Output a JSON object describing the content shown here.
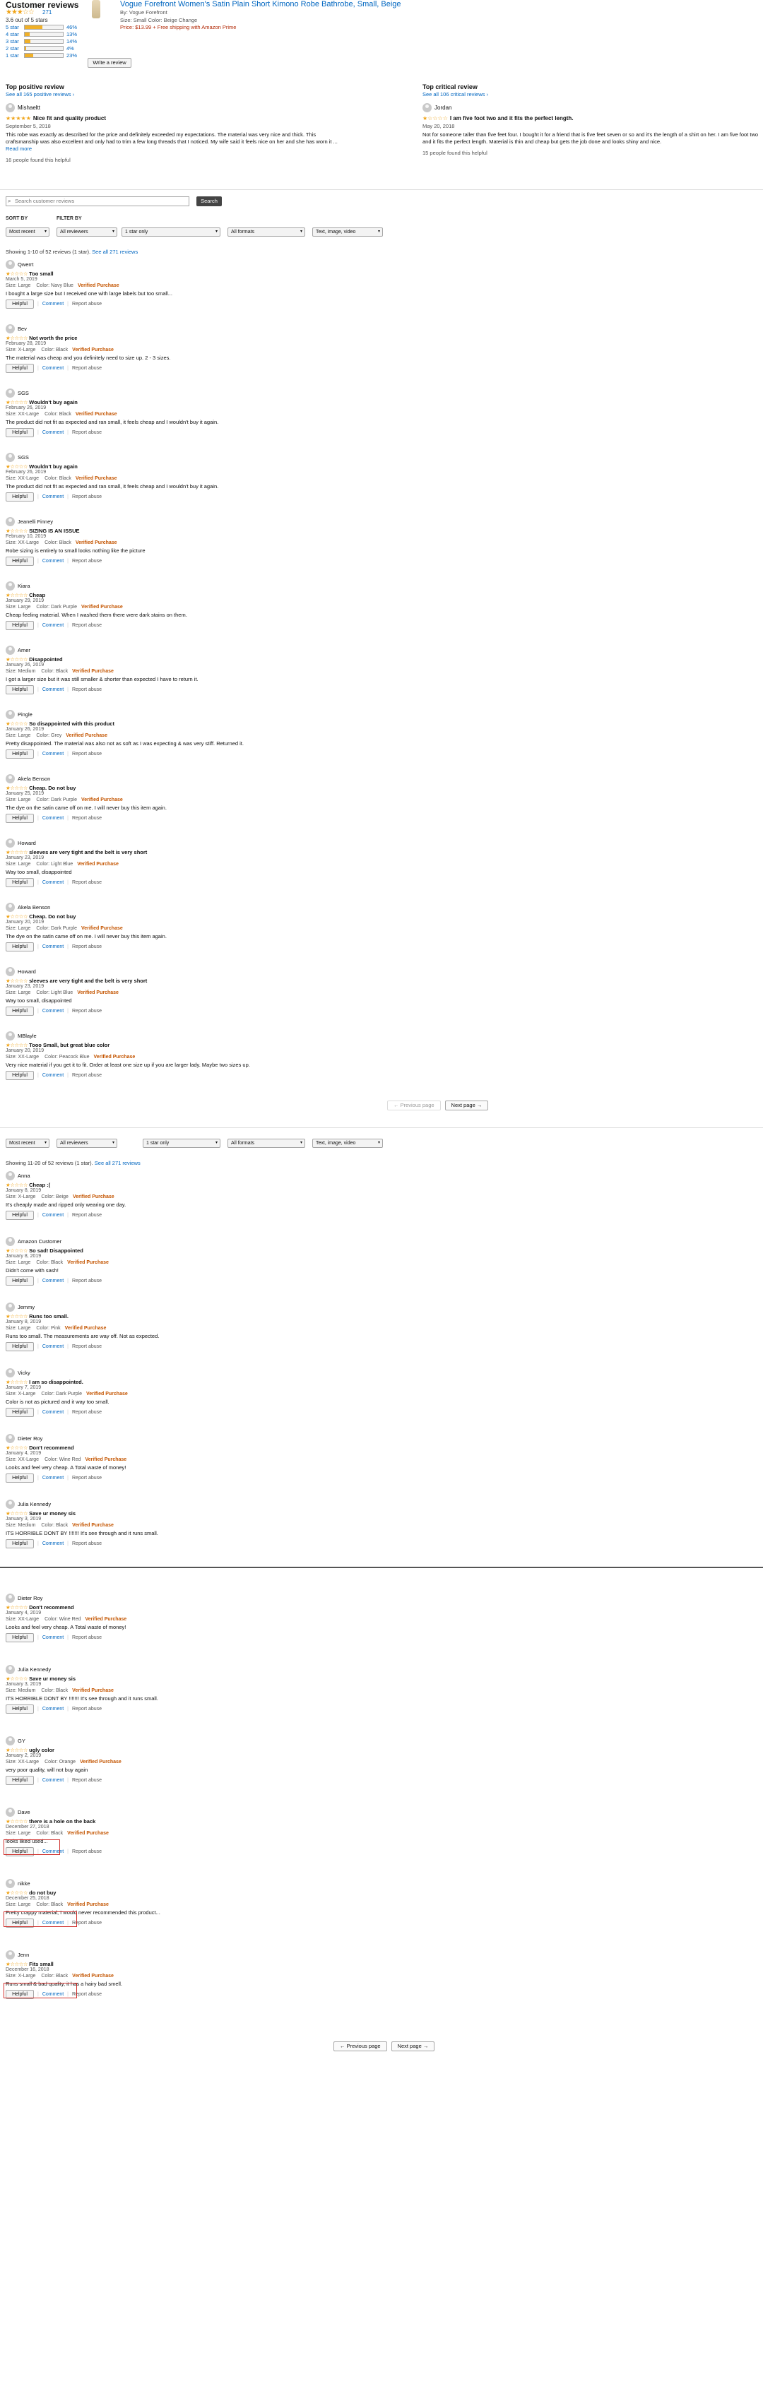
{
  "header": {
    "title": "Customer reviews",
    "avg_stars": "★★★☆☆",
    "review_count": "271",
    "out_of": "3.6 out of 5 stars",
    "histogram": [
      {
        "label": "5 star",
        "pct": "46%",
        "value": 46
      },
      {
        "label": "4 star",
        "pct": "13%",
        "value": 13
      },
      {
        "label": "3 star",
        "pct": "14%",
        "value": 14
      },
      {
        "label": "2 star",
        "pct": "4%",
        "value": 4
      },
      {
        "label": "1 star",
        "pct": "23%",
        "value": 23
      }
    ],
    "write_review": "Write a review"
  },
  "product": {
    "title": "Vogue Forefront Women's Satin Plain Short Kimono Robe Bathrobe, Small, Beige",
    "by": "By: Vogue Forefront",
    "meta": "Size: Small    Color: Beige    Change",
    "price": "Price: $13.99 + Free shipping with Amazon Prime"
  },
  "top_positive": {
    "heading": "Top positive review",
    "sub": "See all 165 positive reviews ›",
    "user": "Mishaeltt",
    "stars": "★★★★★",
    "title": "Nice fit and quality product",
    "date": "September 5, 2018",
    "text": "This robe was exactly as described for the price and definitely exceeded my expectations. The material was very nice and thick. This craftsmanship was also excellent and only had to trim a few long threads that I noticed. My wife said it feels nice on her and she has worn it ...",
    "more": "Read more",
    "found": "16 people found this helpful"
  },
  "top_critical": {
    "heading": "Top critical review",
    "sub": "See all 106 critical reviews ›",
    "user": "Jordan",
    "stars": "★☆☆☆☆",
    "title": "I am five foot two and it fits the perfect length.",
    "date": "May 20, 2018",
    "text": "Not for someone taller than five feet four. I bought it for a friend that is five feet seven or so and it's the length of a shirt on her. I am five foot two and it fits the perfect length. Material is thin and cheap but gets the job done and looks shiny and nice.",
    "found": "15 people found this helpful"
  },
  "search": {
    "placeholder": "Search customer reviews",
    "button": "Search"
  },
  "filters": {
    "sort_label": "SORT BY",
    "filter_label": "FILTER BY",
    "sort": "Most recent",
    "reviewers": "All reviewers",
    "stars": "1 star only",
    "formats": "All formats",
    "media": "Text, image, video"
  },
  "showing_1": {
    "text": "Showing 1-10 of 52 reviews (1 star).",
    "link": "See all 271 reviews"
  },
  "showing_2": {
    "text": "Showing 11-20 of 52 reviews (1 star).",
    "link": "See all 271 reviews"
  },
  "labels": {
    "helpful": "Helpful",
    "comment": "Comment",
    "report": "Report abuse",
    "verified": "Verified Purchase",
    "prev": "← Previous page",
    "next": "Next page →"
  },
  "reviews_1": [
    {
      "user": "Qwerrt",
      "stars": "★☆☆☆☆",
      "title": "Too small",
      "date": "March 5, 2019",
      "size": "Size: Large",
      "color": "Color: Navy Blue",
      "text": "I bought a large size but I received one with large labels but too small..."
    },
    {
      "user": "Bev",
      "stars": "★☆☆☆☆",
      "title": "Not worth the price",
      "date": "February 28, 2019",
      "size": "Size: X-Large",
      "color": "Color: Black",
      "text": "The material was cheap and you definitely need to size up. 2 - 3 sizes."
    },
    {
      "user": "SGS",
      "stars": "★☆☆☆☆",
      "title": "Wouldn't buy again",
      "date": "February 26, 2019",
      "size": "Size: XX-Large",
      "color": "Color: Black",
      "text": "The product did not fit as expected and ran small, it feels cheap and I wouldn't buy it again."
    },
    {
      "user": "SGS",
      "stars": "★☆☆☆☆",
      "title": "Wouldn't buy again",
      "date": "February 26, 2019",
      "size": "Size: XX-Large",
      "color": "Color: Black",
      "text": "The product did not fit as expected and ran small, it feels cheap and I wouldn't buy it again."
    },
    {
      "user": "Jeanelli Finney",
      "stars": "★☆☆☆☆",
      "title": "SIZING IS AN ISSUE",
      "date": "February 10, 2019",
      "size": "Size: XX-Large",
      "color": "Color: Black",
      "text": "Robe sizing is entirely to small looks nothing like the picture"
    },
    {
      "user": "Kiara",
      "stars": "★☆☆☆☆",
      "title": "Cheap",
      "date": "January 29, 2019",
      "size": "Size: Large",
      "color": "Color: Dark Purple",
      "text": "Cheap feeling material. When I washed them there were dark stains on them."
    },
    {
      "user": "Amer",
      "stars": "★☆☆☆☆",
      "title": "Disappointed",
      "date": "January 26, 2019",
      "size": "Size: Medium",
      "color": "Color: Black",
      "text": "I got a larger size but it was still smaller & shorter than expected I have to return it."
    },
    {
      "user": "Pingle",
      "stars": "★☆☆☆☆",
      "title": "So disappointed with this product",
      "date": "January 26, 2019",
      "size": "Size: Large",
      "color": "Color: Grey",
      "text": "Pretty disappointed. The material was also not as soft as I was expecting & was very stiff. Returned it."
    },
    {
      "user": "Akela Benson",
      "stars": "★☆☆☆☆",
      "title": "Cheap. Do not buy",
      "date": "January 25, 2019",
      "size": "Size: Large",
      "color": "Color: Dark Purple",
      "text": "The dye on the satin came off on me. I will never buy this item again."
    },
    {
      "user": "Howard",
      "stars": "★☆☆☆☆",
      "title": "sleeves are very tight and the belt is very short",
      "date": "January 23, 2019",
      "size": "Size: Large",
      "color": "Color: Light Blue",
      "text": "Way too small, disappointed"
    },
    {
      "user": "Akela Benson",
      "stars": "★☆☆☆☆",
      "title": "Cheap. Do not buy",
      "date": "January 20, 2019",
      "size": "Size: Large",
      "color": "Color: Dark Purple",
      "text": "The dye on the satin came off on me. I will never buy this item again."
    },
    {
      "user": "Howard",
      "stars": "★☆☆☆☆",
      "title": "sleeves are very tight and the belt is very short",
      "date": "January 23, 2019",
      "size": "Size: Large",
      "color": "Color: Light Blue",
      "text": "Way too small, disappointed"
    },
    {
      "user": "MBlayle",
      "stars": "★☆☆☆☆",
      "title": "Tooo Small, but great blue color",
      "date": "January 20, 2019",
      "size": "Size: XX-Large",
      "color": "Color: Peacock Blue",
      "text": "Very nice material if you get it to fit. Order at least one size up if you are larger lady. Maybe two sizes up."
    }
  ],
  "reviews_2": [
    {
      "user": "Anna",
      "stars": "★☆☆☆☆",
      "title": "Cheap :(",
      "date": "January 8, 2019",
      "size": "Size: X-Large",
      "color": "Color: Beige",
      "text": "It's cheaply made and ripped only wearing one day."
    },
    {
      "user": "Amazon Customer",
      "stars": "★☆☆☆☆",
      "title": "So sad! Disappointed",
      "date": "January 8, 2019",
      "size": "Size: Large",
      "color": "Color: Black",
      "text": "Didn't come with sash!"
    },
    {
      "user": "Jemmy",
      "stars": "★☆☆☆☆",
      "title": "Runs too small.",
      "date": "January 8, 2019",
      "size": "Size: Large",
      "color": "Color: Pink",
      "text": "Runs too small. The measurements are way off. Not as expected."
    },
    {
      "user": "Vicky",
      "stars": "★☆☆☆☆",
      "title": "I am so disappointed.",
      "date": "January 7, 2019",
      "size": "Size: X-Large",
      "color": "Color: Dark Purple",
      "text": "Color is not as pictured and it way too small."
    },
    {
      "user": "Dieter Roy",
      "stars": "★☆☆☆☆",
      "title": "Don't recommend",
      "date": "January 4, 2019",
      "size": "Size: XX-Large",
      "color": "Color: Wine Red",
      "text": "Looks and feel very cheap. A Total waste of money!"
    },
    {
      "user": "Julia Kennedy",
      "stars": "★☆☆☆☆",
      "title": "Save ur money sis",
      "date": "January 3, 2019",
      "size": "Size: Medium",
      "color": "Color: Black",
      "text": "ITS HORRIBLE DONT BY !!!!!!! It's see through and it runs small."
    }
  ],
  "reviews_3": [
    {
      "user": "Dieter Roy",
      "stars": "★☆☆☆☆",
      "title": "Don't recommend",
      "date": "January 4, 2019",
      "size": "Size: XX-Large",
      "color": "Color: Wine Red",
      "text": "Looks and feel very cheap. A Total waste of money!"
    },
    {
      "user": "Julia Kennedy",
      "stars": "★☆☆☆☆",
      "title": "Save ur money sis",
      "date": "January 3, 2019",
      "size": "Size: Medium",
      "color": "Color: Black",
      "text": "ITS HORRIBLE DONT BY !!!!!!! It's see through and it runs small."
    },
    {
      "user": "GY",
      "stars": "★☆☆☆☆",
      "title": "ugly color",
      "date": "January 2, 2019",
      "size": "Size: XX-Large",
      "color": "Color: Orange",
      "text": "very poor quality, will not buy again"
    },
    {
      "user": "Dave",
      "stars": "★☆☆☆☆",
      "title": "there is a hole on the back",
      "date": "December 27, 2018",
      "size": "Size: Large",
      "color": "Color: Black",
      "text": "looks liked used..."
    },
    {
      "user": "nikke",
      "stars": "★☆☆☆☆",
      "title": "do not buy",
      "date": "December 25, 2018",
      "size": "Size: Large",
      "color": "Color: Black",
      "text": "Pretty crappy material, I would never recommended this product..."
    },
    {
      "user": "Jenn",
      "stars": "★☆☆☆☆",
      "title": "Fits small",
      "date": "December 16, 2018",
      "size": "Size: X-Large",
      "color": "Color: Black",
      "text": "Runs small & bad quality, it has a hairy bad smell."
    }
  ]
}
